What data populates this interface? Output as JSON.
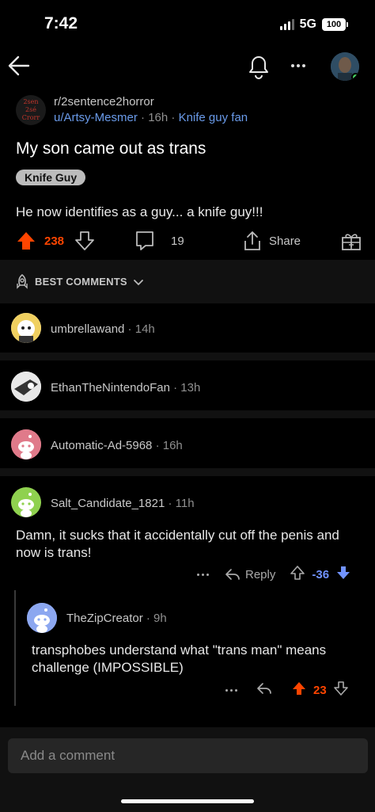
{
  "status": {
    "time": "7:42",
    "network": "5G",
    "battery": "100"
  },
  "post": {
    "subreddit": "r/2sentence2horror",
    "author": "u/Artsy-Mesmer",
    "age": "16h",
    "flair_text": "Knife guy fan",
    "title": "My son came out as trans",
    "flair": "Knife Guy",
    "body": "He now identifies as a guy... a knife guy!!!",
    "upvotes": "238",
    "comments": "19",
    "share_label": "Share",
    "subreddit_icon_lines": [
      "2sen",
      "2sé",
      "Crorr"
    ]
  },
  "sort": {
    "label": "BEST COMMENTS"
  },
  "comments": [
    {
      "author": "umbrellawand",
      "time": "14h"
    },
    {
      "author": "EthanTheNintendoFan",
      "time": "13h"
    },
    {
      "author": "Automatic-Ad-5968",
      "time": "16h"
    },
    {
      "author": "Salt_Candidate_1821",
      "time": "11h",
      "body": "Damn, it sucks that it accidentally cut off the penis and now is trans!",
      "reply_label": "Reply",
      "score": "-36"
    },
    {
      "author": "TheZipCreator",
      "time": "9h",
      "body": "transphobes understand what \"trans man\" means challenge (IMPOSSIBLE)",
      "score": "23"
    }
  ],
  "composer": {
    "placeholder": "Add a comment"
  },
  "colors": {
    "upvote": "#ff4500",
    "downvote": "#7193ff",
    "link": "#6a9bea",
    "background": "#000000"
  },
  "icons": [
    "back-arrow-icon",
    "bell-icon",
    "more-icon",
    "upvote-icon",
    "downvote-icon",
    "comment-icon",
    "share-icon",
    "award-icon",
    "reply-icon",
    "chevron-down-icon"
  ]
}
